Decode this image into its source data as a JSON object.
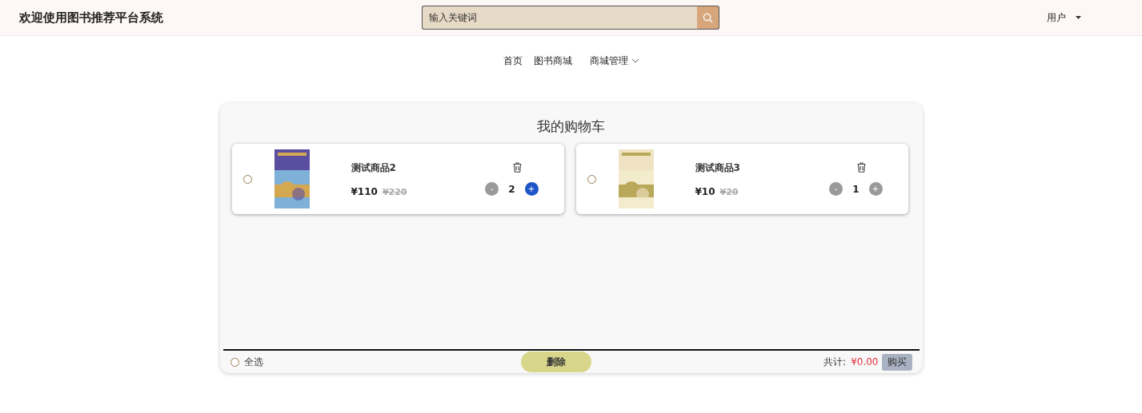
{
  "header": {
    "title": "欢迎使用图书推荐平台系统",
    "search": {
      "placeholder": "输入关键词"
    },
    "user_menu": "用户"
  },
  "nav": [
    {
      "label": "首页",
      "dropdown": false
    },
    {
      "label": "图书商城",
      "dropdown": false
    },
    {
      "label": "商城管理",
      "dropdown": true
    }
  ],
  "cart": {
    "title": "我的购物车",
    "items": [
      {
        "name": "测试商品2",
        "price": "¥110",
        "original_price": "¥220",
        "quantity": "2",
        "minus": "-",
        "plus": "+",
        "plus_hovered": true,
        "selected": false
      },
      {
        "name": "测试商品3",
        "price": "¥10",
        "original_price": "¥20",
        "quantity": "1",
        "minus": "-",
        "plus": "+",
        "plus_hovered": false,
        "selected": false
      }
    ],
    "footer": {
      "select_all": {
        "label": "全选",
        "selected": false
      },
      "delete_button": "删除",
      "total_label": "共计:",
      "total": "¥0.00",
      "buy_button": "购买"
    }
  }
}
